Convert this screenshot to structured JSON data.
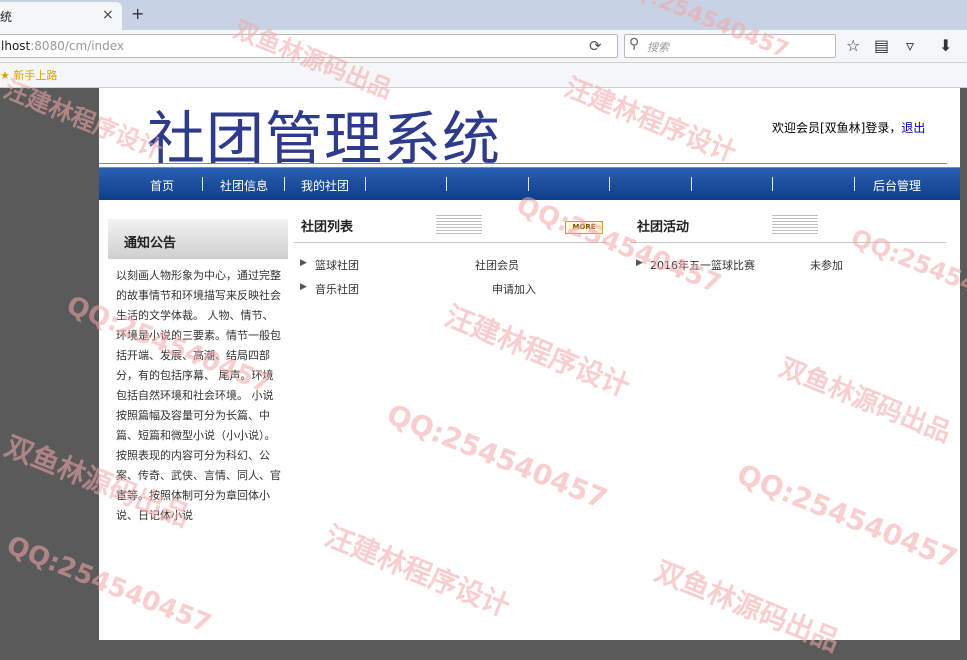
{
  "browser": {
    "tab_title": "统",
    "tab_close": "×",
    "new_tab": "+",
    "url_host": "lhost",
    "url_rest": ":8080/cm/index",
    "search_placeholder": "搜索",
    "bookmark_label": "新手上路"
  },
  "header": {
    "logo": "社团管理系统",
    "welcome_prefix": "欢迎会员[双鱼林]登录，",
    "logout": "退出"
  },
  "menu": {
    "items": [
      "首页",
      "社团信息",
      "我的社团",
      "后台管理"
    ]
  },
  "notice": {
    "title": "通知公告",
    "body": "以刻画人物形象为中心，通过完整的故事情节和环境描写来反映社会生活的文学体裁。 人物、情节、环境是小说的三要素。情节一般包括开端、发展、高潮、结局四部分，有的包括序幕、 尾声。环境包括自然环境和社会环境。 小说按照篇幅及容量可分为长篇、中篇、短篇和微型小说（小小说）。 按照表现的内容可分为科幻、公案、传奇、武侠、言情、同人、官宦等。按照体制可分为章回体小说、日记体小说"
  },
  "clubs": {
    "title": "社团列表",
    "more": "MORE",
    "rows": [
      {
        "name": "篮球社团",
        "status": "社团会员"
      },
      {
        "name": "音乐社团",
        "status": "申请加入"
      }
    ]
  },
  "activities": {
    "title": "社团活动",
    "rows": [
      {
        "name": "2016年五一篮球比赛",
        "status": "未参加"
      }
    ]
  },
  "watermarks": [
    "QQ:254540457",
    "汪建林程序设计",
    "双鱼林源码出品"
  ],
  "colors": {
    "logo": "#2e3a8c",
    "menu": "#1a4d9e",
    "watermark": "#f3a7a7"
  }
}
